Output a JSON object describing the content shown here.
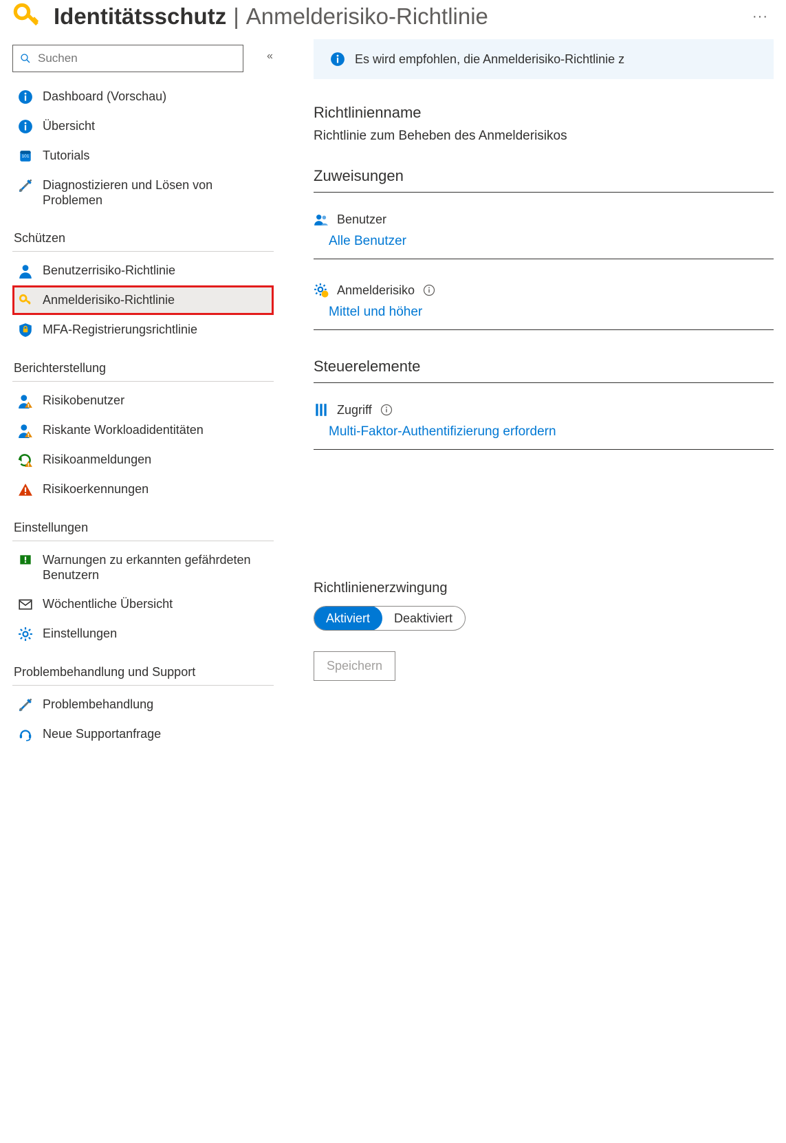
{
  "header": {
    "title_strong": "Identitätsschutz",
    "separator": "|",
    "title_sub": "Anmelderisiko-Richtlinie",
    "more_glyph": "···"
  },
  "search": {
    "placeholder": "Suchen"
  },
  "collapse_glyph": "«",
  "nav": {
    "top": [
      {
        "label": "Dashboard (Vorschau)"
      },
      {
        "label": "Übersicht"
      },
      {
        "label": "Tutorials"
      },
      {
        "label": "Diagnostizieren und Lösen von Problemen"
      }
    ],
    "sections": [
      {
        "header": "Schützen",
        "items": [
          {
            "label": "Benutzerrisiko-Richtlinie"
          },
          {
            "label": "Anmelderisiko-Richtlinie",
            "selected": true,
            "highlighted": true
          },
          {
            "label": "MFA-Registrierungsrichtlinie"
          }
        ]
      },
      {
        "header": "Berichterstellung",
        "items": [
          {
            "label": "Risikobenutzer"
          },
          {
            "label": "Riskante Workloadidentitäten"
          },
          {
            "label": "Risikoanmeldungen"
          },
          {
            "label": "Risikoerkennungen"
          }
        ]
      },
      {
        "header": "Einstellungen",
        "items": [
          {
            "label": "Warnungen zu erkannten gefährdeten Benutzern"
          },
          {
            "label": "Wöchentliche Übersicht"
          },
          {
            "label": "Einstellungen"
          }
        ]
      },
      {
        "header": "Problembehandlung und Support",
        "items": [
          {
            "label": "Problembehandlung"
          },
          {
            "label": "Neue Supportanfrage"
          }
        ]
      }
    ]
  },
  "main": {
    "info_banner": "Es wird empfohlen, die Anmelderisiko-Richtlinie z",
    "policy_name_label": "Richtlinienname",
    "policy_name_value": "Richtlinie zum Beheben des Anmelderisikos",
    "assignments": {
      "header": "Zuweisungen",
      "users_label": "Benutzer",
      "users_value": "Alle Benutzer",
      "risk_label": "Anmelderisiko",
      "risk_value": "Mittel und höher"
    },
    "controls": {
      "header": "Steuerelemente",
      "access_label": "Zugriff",
      "access_value": "Multi-Faktor-Authentifizierung erfordern"
    },
    "enforcement": {
      "label": "Richtlinienerzwingung",
      "enabled": "Aktiviert",
      "disabled": "Deaktiviert"
    },
    "save_label": "Speichern"
  },
  "colors": {
    "accent": "#0078d4",
    "amber": "#ffb900",
    "orange": "#d83b01",
    "warn": "#e38800",
    "banner_bg": "#eff6fc"
  }
}
